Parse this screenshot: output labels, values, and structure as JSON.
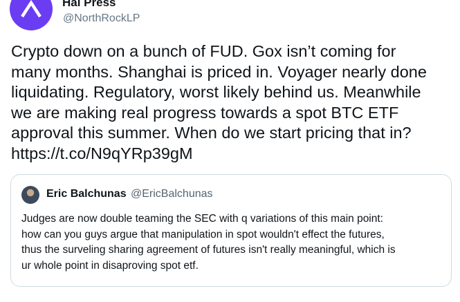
{
  "author": {
    "name": "Hal Press",
    "handle": "@NorthRockLP"
  },
  "tweet": {
    "lines": [
      "Crypto down on a bunch of FUD. Gox isn’t coming for",
      "many months. Shanghai is priced in. Voyager nearly done",
      "liquidating. Regulatory, worst likely behind us. Meanwhile",
      "we are making real progress towards a spot BTC ETF",
      "approval this summer. When do we start pricing that in?",
      "https://t.co/N9qYRp39gM"
    ]
  },
  "quote": {
    "author_name": "Eric Balchunas",
    "author_handle": "@EricBalchunas",
    "lines": [
      "Judges are now double teaming the SEC with q variations of this main point:",
      "how can you guys argue that manipulation in spot wouldn't effect the futures,",
      "thus the surveling sharing agreement of futures isn't really meaningful, which is",
      "ur whole point in disaproving spot etf."
    ]
  },
  "colors": {
    "avatar_bg": "#6b3df2",
    "text_primary": "#0f1419",
    "text_secondary": "#657786",
    "card_border": "#cfd9de"
  },
  "icons": {
    "avatar": "chevron-up-logo"
  }
}
